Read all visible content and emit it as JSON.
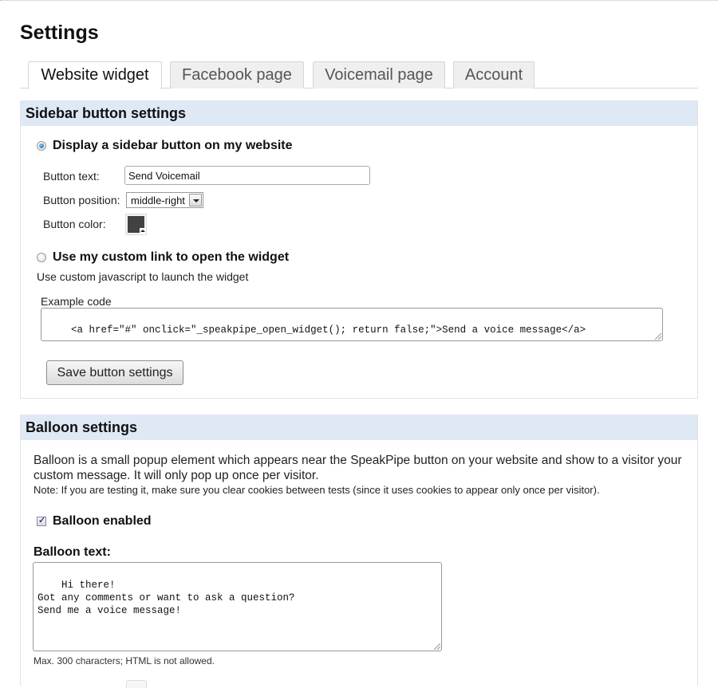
{
  "page": {
    "title": "Settings"
  },
  "tabs": [
    {
      "label": "Website widget",
      "active": true
    },
    {
      "label": "Facebook page",
      "active": false
    },
    {
      "label": "Voicemail page",
      "active": false
    },
    {
      "label": "Account",
      "active": false
    }
  ],
  "sidebar_section": {
    "header": "Sidebar button settings",
    "option_display": {
      "label": "Display a sidebar button on my website",
      "selected": true
    },
    "button_text": {
      "label": "Button text:",
      "value": "Send Voicemail"
    },
    "button_position": {
      "label": "Button position:",
      "value": "middle-right"
    },
    "button_color": {
      "label": "Button color:",
      "value": "#424242"
    },
    "option_custom": {
      "label": "Use my custom link to open the widget",
      "selected": false
    },
    "custom_desc": "Use custom javascript to launch the widget",
    "example_label": "Example code",
    "example_code": "<a href=\"#\" onclick=\"_speakpipe_open_widget(); return false;\">Send a voice message</a>",
    "save_label": "Save button settings"
  },
  "balloon_section": {
    "header": "Balloon settings",
    "description": "Balloon is a small popup element which appears near the SpeakPipe button on your website and show to a visitor your custom message. It will only pop up once per visitor.",
    "note": "Note: If you are testing it, make sure you clear cookies between tests (since it uses cookies to appear only once per visitor).",
    "enabled": {
      "label": "Balloon enabled",
      "checked": true
    },
    "text_label": "Balloon text:",
    "text_value": "Hi there!\nGot any comments or want to ask a question?\nSend me a voice message!",
    "hint": "Max. 300 characters; HTML is not allowed."
  },
  "colors": {
    "section_header_bg": "#dfe8f5",
    "tab_inactive_bg": "#efefef",
    "button_color_swatch": "#424242"
  }
}
